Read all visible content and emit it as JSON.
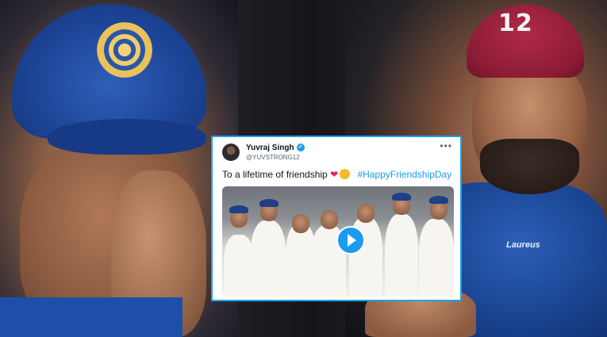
{
  "tweet": {
    "author_name": "Yuvraj Singh",
    "handle": "@YUVSTRONG12",
    "text": "To a lifetime of friendship",
    "hashtag": "#HappyFriendshipDay",
    "more_icon": "more-icon",
    "verified_icon": "verified-badge-icon",
    "media_type": "video"
  },
  "cap_right_number": "12",
  "shirt_logo_text": "Laureus",
  "colors": {
    "twitter_blue": "#1d9bf0",
    "card_border": "#1da1f2",
    "india_cap_blue": "#1d4597",
    "maroon_cap": "#8d1c36"
  }
}
